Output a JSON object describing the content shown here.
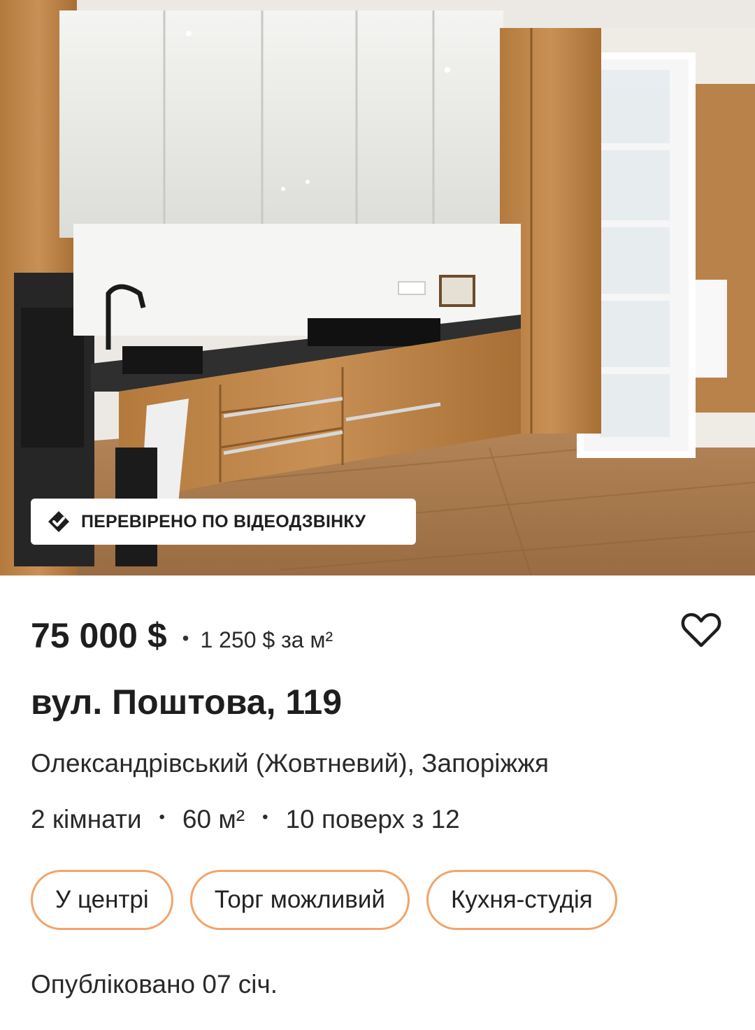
{
  "listing": {
    "photo": {
      "alt": "kitchen-photo"
    },
    "badge": {
      "label": "ПЕРЕВІРЕНО ПО ВІДЕОДЗВІНКУ",
      "icon": "verified-house-icon"
    },
    "price": "75 000 $",
    "separator": "•",
    "price_per_m2": "1 250 $ за м²",
    "favorite_icon": "heart-icon",
    "address": "вул. Поштова, 119",
    "district": "Олександрівський (Жовтневий), Запоріжжя",
    "params": {
      "rooms": "2 кімнати",
      "area": "60 м²",
      "floor": "10 поверх з 12",
      "separator": "•"
    },
    "tags": [
      "У центрі",
      "Торг можливий",
      "Кухня-студія"
    ],
    "published": "Опубліковано 07 січ."
  },
  "colors": {
    "tag_border": "#f2a468",
    "text": "#222222",
    "badge_bg": "#ffffff"
  }
}
